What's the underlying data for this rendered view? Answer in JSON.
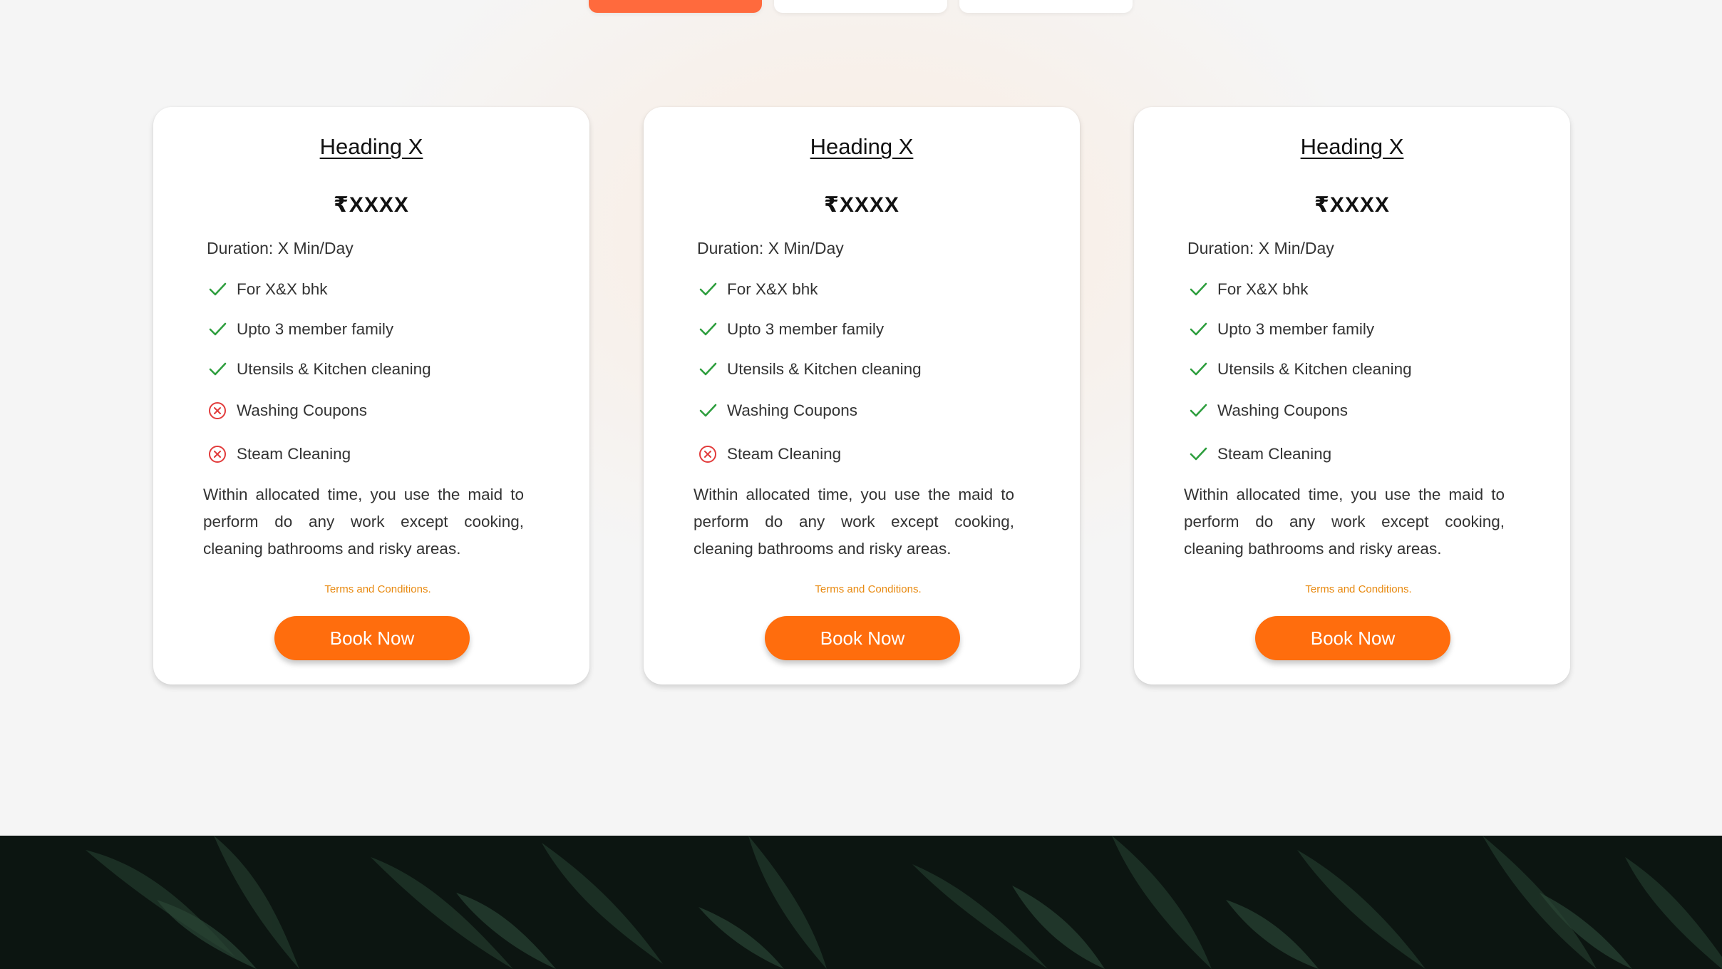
{
  "top_tabs": [
    {
      "label": "",
      "active": true
    },
    {
      "label": "",
      "active": false
    },
    {
      "label": "",
      "active": false
    }
  ],
  "cards": [
    {
      "heading": "Heading X",
      "price": "₹XXXX",
      "duration": "Duration: X Min/Day",
      "features": [
        {
          "text": "For X&X bhk",
          "included": true
        },
        {
          "text": "Upto 3 member family",
          "included": true
        },
        {
          "text": "Utensils & Kitchen cleaning",
          "included": true
        },
        {
          "text": "Washing Coupons",
          "included": false
        },
        {
          "text": "Steam Cleaning",
          "included": false
        }
      ],
      "description": "Within allocated time, you use the maid to perform do any work except cooking, cleaning bathrooms and risky areas.",
      "terms": "Terms and Conditions.",
      "button": "Book Now"
    },
    {
      "heading": "Heading X",
      "price": "₹XXXX",
      "duration": "Duration: X Min/Day",
      "features": [
        {
          "text": "For X&X bhk",
          "included": true
        },
        {
          "text": "Upto 3 member family",
          "included": true
        },
        {
          "text": "Utensils & Kitchen cleaning",
          "included": true
        },
        {
          "text": "Washing Coupons",
          "included": true
        },
        {
          "text": "Steam Cleaning",
          "included": false
        }
      ],
      "description": "Within allocated time, you use the maid to perform do any work except cooking, cleaning bathrooms and risky areas.",
      "terms": "Terms and Conditions.",
      "button": "Book Now"
    },
    {
      "heading": "Heading X",
      "price": "₹XXXX",
      "duration": "Duration: X Min/Day",
      "features": [
        {
          "text": "For X&X bhk",
          "included": true
        },
        {
          "text": "Upto 3 member family",
          "included": true
        },
        {
          "text": "Utensils & Kitchen cleaning",
          "included": true
        },
        {
          "text": "Washing Coupons",
          "included": true
        },
        {
          "text": "Steam Cleaning",
          "included": true
        }
      ],
      "description": "Within allocated time, you use the maid to perform do any work except cooking, cleaning bathrooms and risky areas.",
      "terms": "Terms and Conditions.",
      "button": "Book Now"
    }
  ],
  "colors": {
    "accent": "#ff6d0d",
    "active_tab": "#ff6a3d",
    "check": "#2e9e3e",
    "cross": "#e23b3b",
    "terms": "#e8890f",
    "footer": "#0c1511"
  },
  "icons": {
    "included": "check-icon",
    "excluded": "cross-circle-icon"
  }
}
